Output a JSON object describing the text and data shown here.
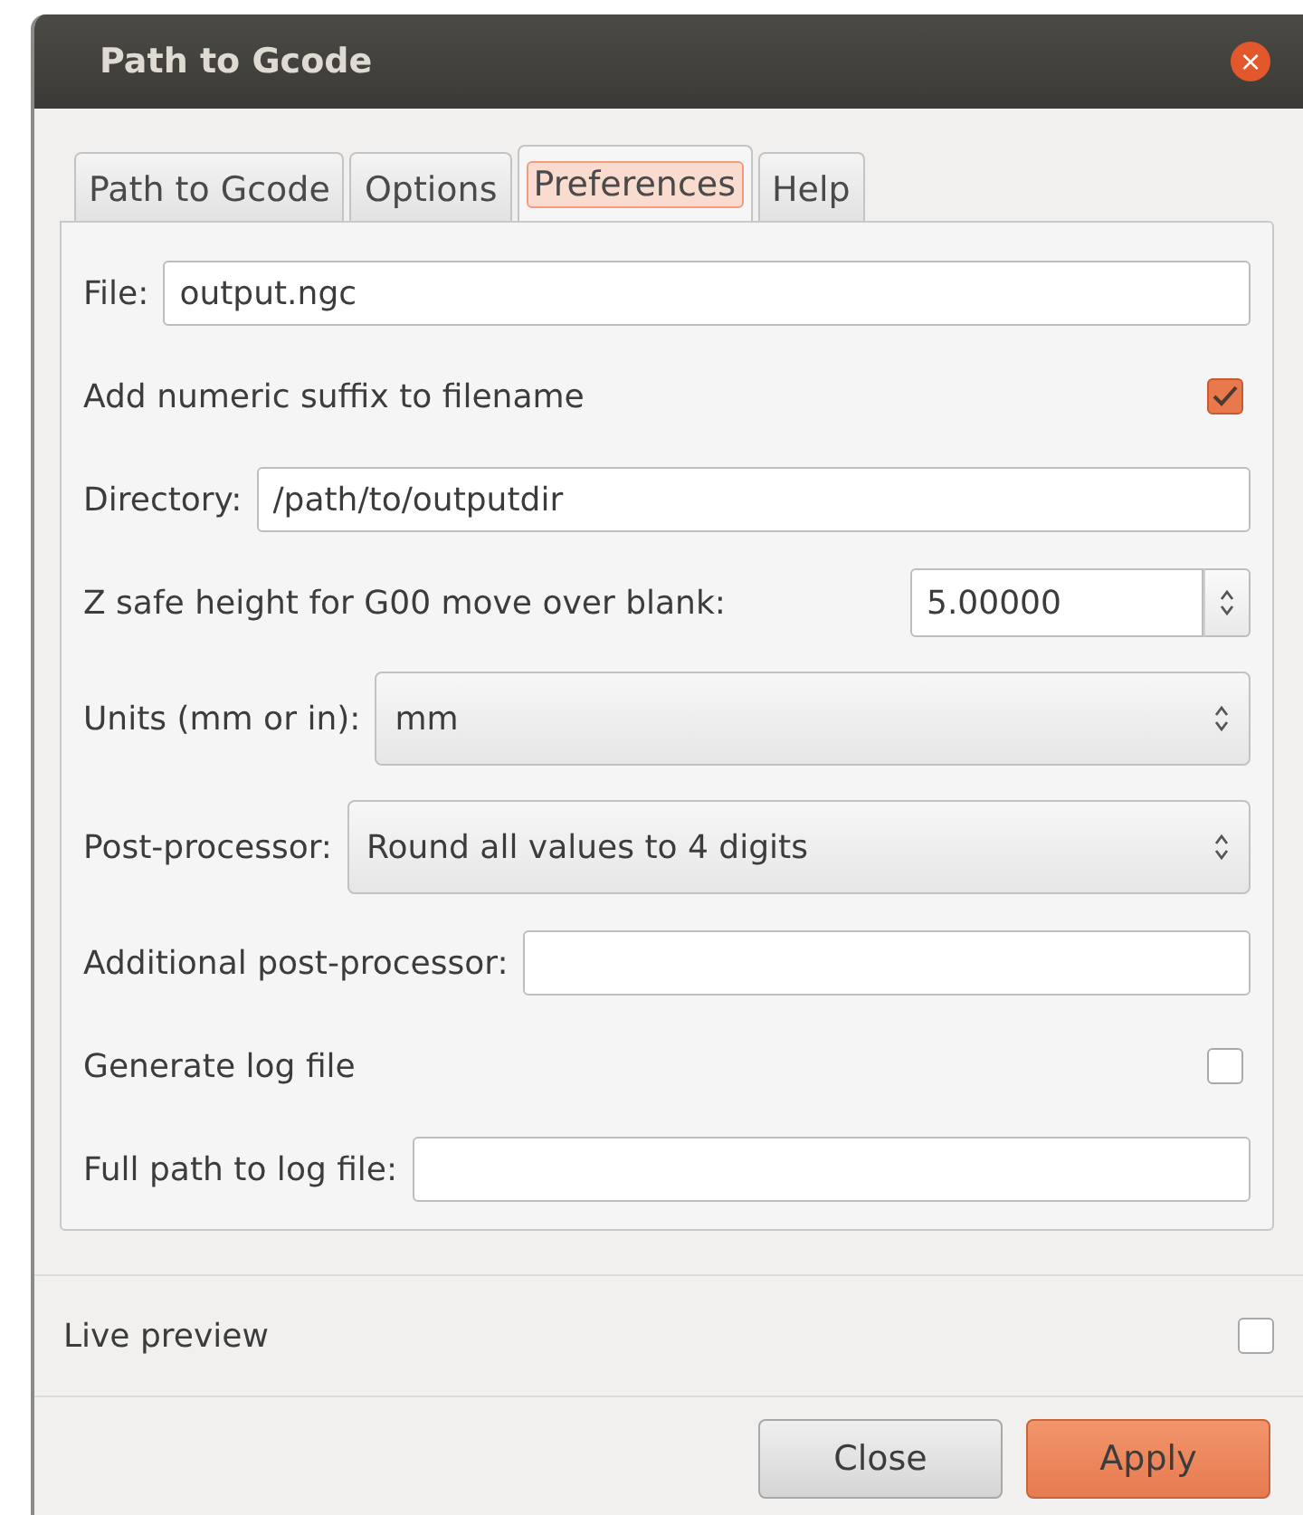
{
  "window": {
    "title": "Path to Gcode",
    "close": "×"
  },
  "tabs": [
    {
      "label": "Path to Gcode",
      "selected": false
    },
    {
      "label": "Options",
      "selected": false
    },
    {
      "label": "Preferences",
      "selected": true
    },
    {
      "label": "Help",
      "selected": false
    }
  ],
  "rows": [
    {
      "kind": "text",
      "label": "File:",
      "value": "output.ngc"
    },
    {
      "kind": "checkbox",
      "label": "Add numeric suffix to filename",
      "checked": true
    },
    {
      "kind": "text",
      "label": "Directory:",
      "value": "/path/to/outputdir"
    },
    {
      "kind": "spin",
      "label": "Z safe height for G00 move over blank:",
      "value": "5.00000"
    },
    {
      "kind": "combo",
      "label": "Units (mm or in):",
      "value": "mm"
    },
    {
      "kind": "combo",
      "label": "Post-processor:",
      "value": "Round all values to 4 digits"
    },
    {
      "kind": "text",
      "label": "Additional post-processor:",
      "value": ""
    },
    {
      "kind": "checkbox",
      "label": "Generate log file",
      "checked": false
    },
    {
      "kind": "text",
      "label": "Full path to log file:",
      "value": ""
    }
  ],
  "live_preview": {
    "label": "Live preview",
    "checked": false
  },
  "buttons": [
    {
      "label": "Close",
      "kind": "secondary"
    },
    {
      "label": "Apply",
      "kind": "primary"
    }
  ]
}
